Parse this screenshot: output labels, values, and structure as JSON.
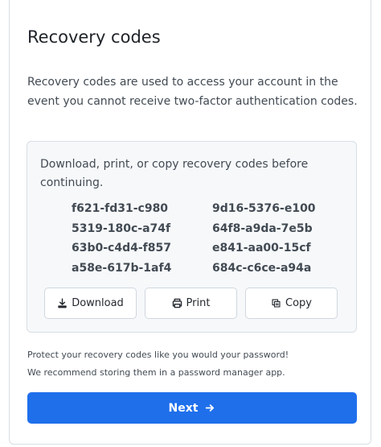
{
  "page": {
    "title": "Recovery codes",
    "intro": "Recovery codes are used to access your account in the event you cannot receive two-factor authentication codes."
  },
  "codes_panel": {
    "instructions": "Download, print, or copy recovery codes before continuing.",
    "codes": [
      "f621-fd31-c980",
      "9d16-5376-e100",
      "5319-180c-a74f",
      "64f8-a9da-7e5b",
      "63b0-c4d4-f857",
      "e841-aa00-15cf",
      "a58e-617b-1af4",
      "684c-c6ce-a94a"
    ],
    "buttons": {
      "download": {
        "label": "Download",
        "icon": "download-icon"
      },
      "print": {
        "label": "Print",
        "icon": "print-icon"
      },
      "copy": {
        "label": "Copy",
        "icon": "copy-icon"
      }
    }
  },
  "footer": {
    "line1": "Protect your recovery codes like you would your password!",
    "line2": "We recommend storing them in a password manager app."
  },
  "next": {
    "label": "Next",
    "icon": "arrow-right-icon"
  },
  "colors": {
    "primary": "#1f6feb",
    "panel_background": "#f6f8fa",
    "border": "#d8dee4",
    "text": "#424a53"
  }
}
